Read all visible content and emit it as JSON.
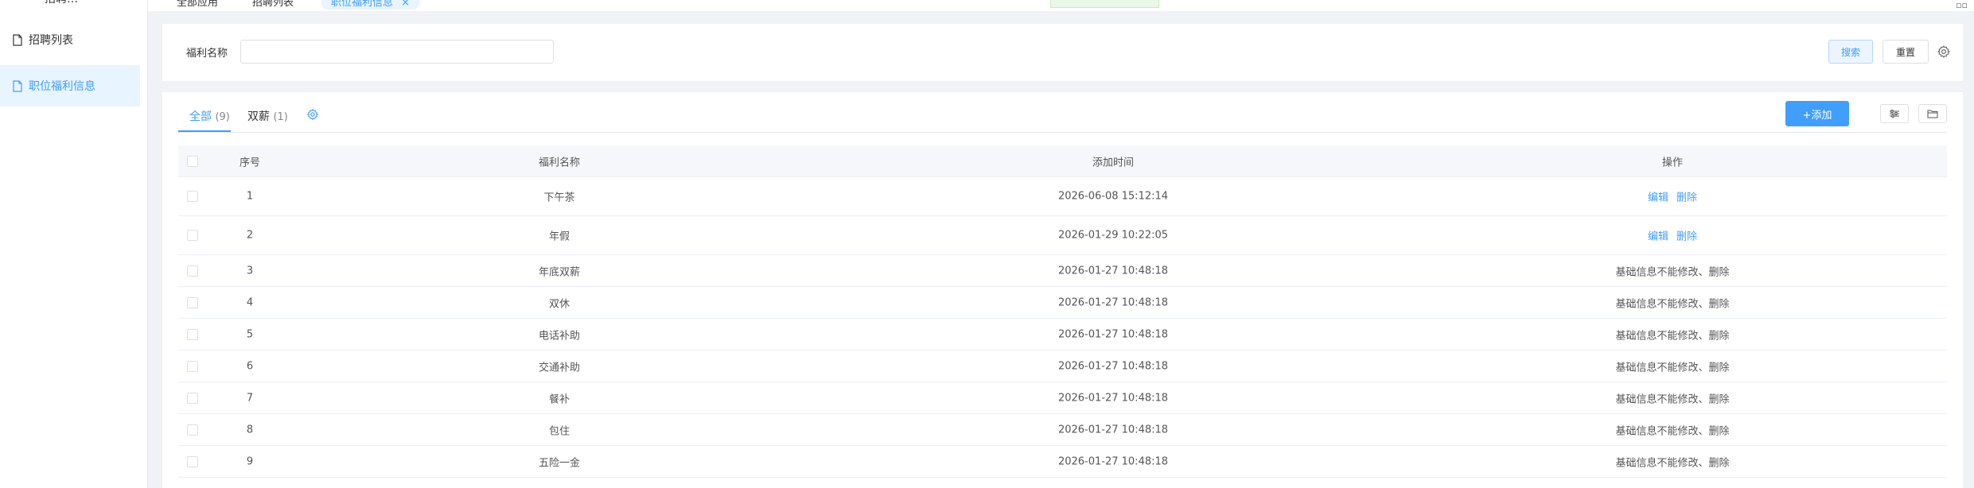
{
  "sidebar": {
    "top_text": "招聘…",
    "items": [
      {
        "label": "招聘列表",
        "icon": "document-icon"
      },
      {
        "label": "职位福利信息",
        "icon": "document-icon"
      }
    ]
  },
  "tabs": [
    {
      "label": "全部应用"
    },
    {
      "label": "招聘列表"
    },
    {
      "label": "职位福利信息",
      "close": "×"
    }
  ],
  "search": {
    "label": "福利名称",
    "input_value": "",
    "search_button": "搜索",
    "reset_button": "重置"
  },
  "filter_tabs": [
    {
      "label": "全部",
      "count": "(9)"
    },
    {
      "label": "双薪",
      "count": "(1)"
    }
  ],
  "toolbar": {
    "add_button": "+添加"
  },
  "table": {
    "headers": [
      "序号",
      "福利名称",
      "添加时间",
      "操作"
    ],
    "edit_label": "编辑",
    "delete_label": "删除",
    "locked_text": "基础信息不能修改、删除",
    "rows": [
      {
        "no": "1",
        "name": "下午茶",
        "time": "2026-06-08 15:12:14",
        "editable": true
      },
      {
        "no": "2",
        "name": "年假",
        "time": "2026-01-29 10:22:05",
        "editable": true
      },
      {
        "no": "3",
        "name": "年底双薪",
        "time": "2026-01-27 10:48:18",
        "editable": false
      },
      {
        "no": "4",
        "name": "双休",
        "time": "2026-01-27 10:48:18",
        "editable": false
      },
      {
        "no": "5",
        "name": "电话补助",
        "time": "2026-01-27 10:48:18",
        "editable": false
      },
      {
        "no": "6",
        "name": "交通补助",
        "time": "2026-01-27 10:48:18",
        "editable": false
      },
      {
        "no": "7",
        "name": "餐补",
        "time": "2026-01-27 10:48:18",
        "editable": false
      },
      {
        "no": "8",
        "name": "包住",
        "time": "2026-01-27 10:48:18",
        "editable": false
      },
      {
        "no": "9",
        "name": "五险一金",
        "time": "2026-01-27 10:48:18",
        "editable": false
      }
    ]
  },
  "colors": {
    "accent": "#409eff",
    "active_bg": "#e8f4ff"
  }
}
